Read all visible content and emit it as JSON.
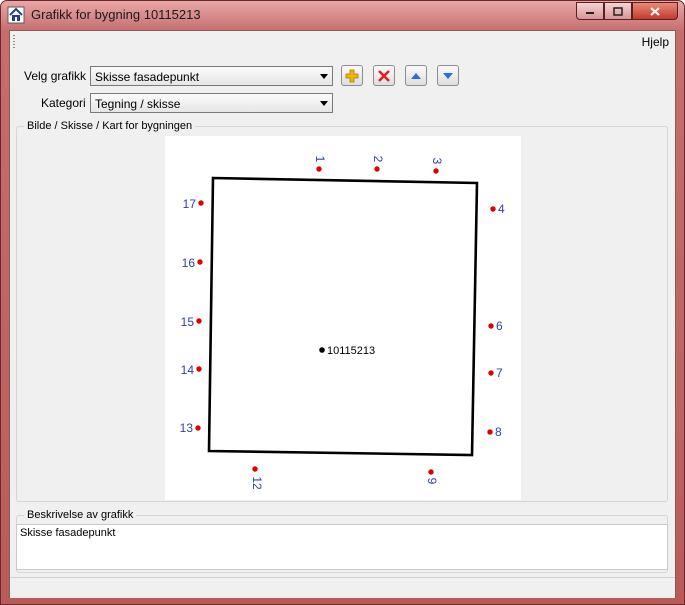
{
  "window": {
    "title": "Grafikk for bygning 10115213",
    "icons": {
      "app": "house-icon",
      "minimize": "minimize-icon",
      "maximize": "maximize-icon",
      "close": "close-icon"
    }
  },
  "menu": {
    "help": "Hjelp"
  },
  "form": {
    "velg_grafikk_label": "Velg grafikk",
    "velg_grafikk_value": "Skisse fasadepunkt",
    "kategori_label": "Kategori",
    "kategori_value": "Tegning / skisse"
  },
  "toolbar": {
    "icons": [
      "add-icon",
      "delete-icon",
      "move-up-icon",
      "move-down-icon"
    ],
    "colors": {
      "add": "#f2b600",
      "delete": "#e02020",
      "arrows": "#2a6fd6"
    }
  },
  "image_group": {
    "title": "Bilde / Skisse / Kart for bygningen"
  },
  "sketch": {
    "building_id": "10115213",
    "point_labels": [
      "1",
      "2",
      "3",
      "4",
      "6",
      "7",
      "8",
      "9",
      "12",
      "13",
      "14",
      "15",
      "16",
      "17"
    ],
    "colors": {
      "point": "#e00000",
      "label": "#2f3fa8",
      "outline": "#000000"
    }
  },
  "description_group": {
    "title": "Beskrivelse av grafikk",
    "text": "Skisse fasadepunkt"
  }
}
